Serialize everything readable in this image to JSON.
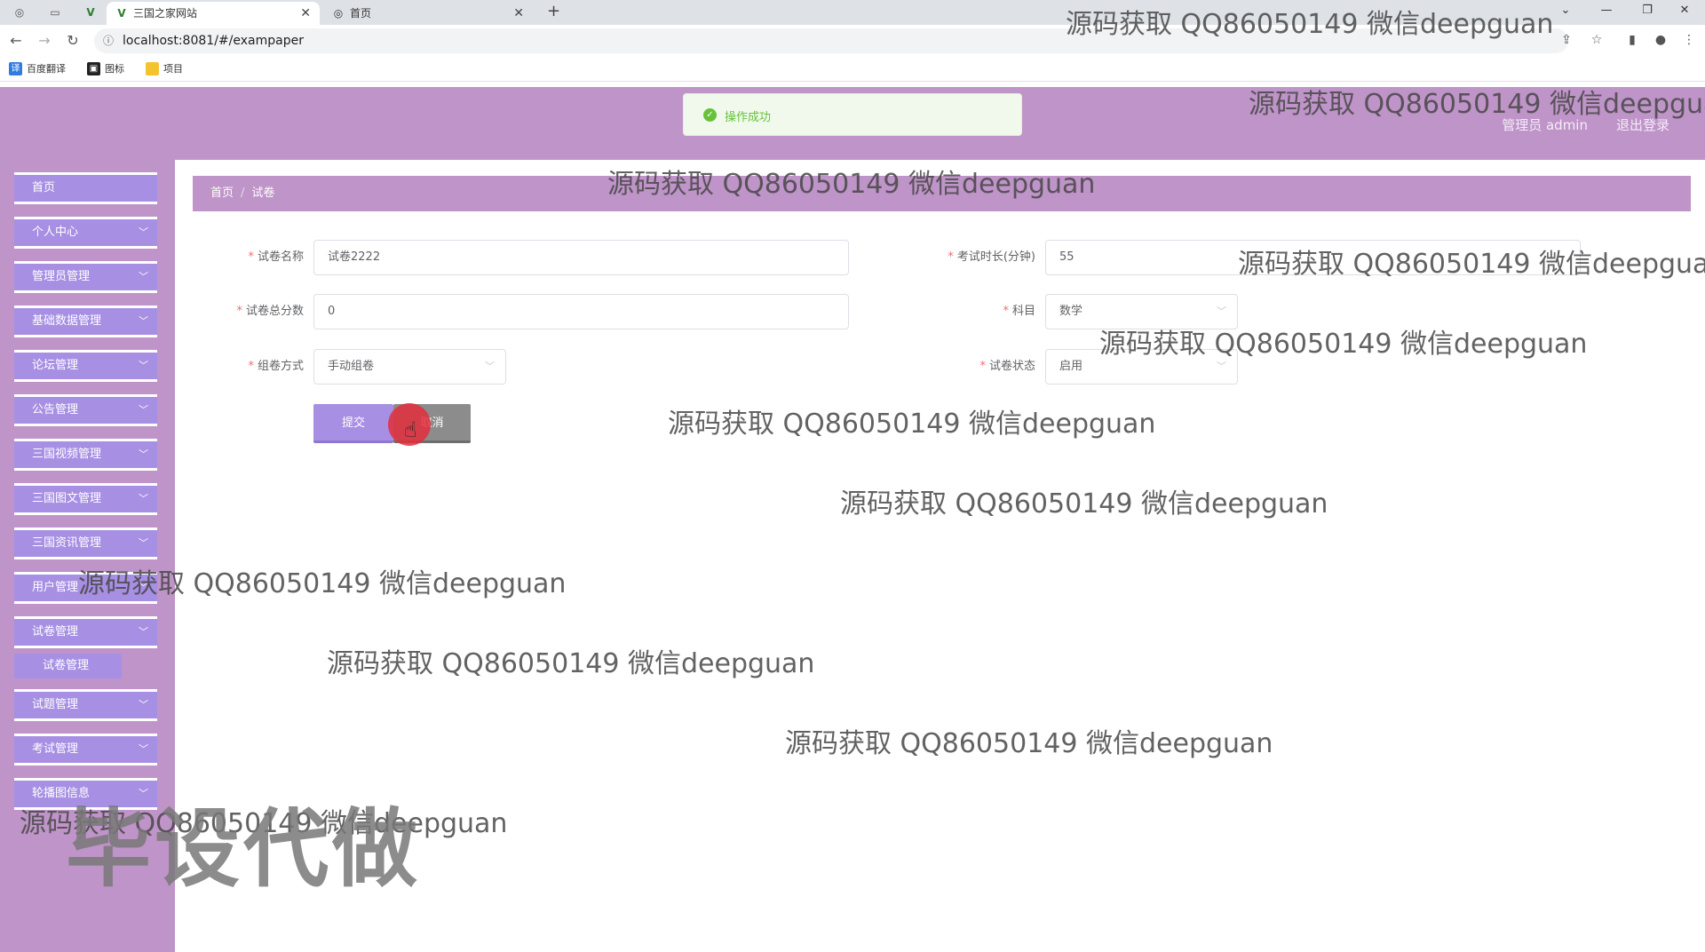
{
  "browser": {
    "tabs": [
      {
        "title": "三国之家网站",
        "active": true
      },
      {
        "title": "首页",
        "active": false
      }
    ],
    "url": "localhost:8081/#/exampaper",
    "bookmarks": [
      "百度翻译",
      "图标",
      "项目"
    ]
  },
  "header": {
    "site_title": "三国之家网站",
    "user_label": "管理员 admin",
    "logout_label": "退出登录"
  },
  "toast": {
    "message": "操作成功"
  },
  "sidebar": {
    "items": [
      {
        "label": "首页",
        "has_children": false
      },
      {
        "label": "个人中心",
        "has_children": true
      },
      {
        "label": "管理员管理",
        "has_children": true
      },
      {
        "label": "基础数据管理",
        "has_children": true
      },
      {
        "label": "论坛管理",
        "has_children": true
      },
      {
        "label": "公告管理",
        "has_children": true
      },
      {
        "label": "三国视频管理",
        "has_children": true
      },
      {
        "label": "三国图文管理",
        "has_children": true
      },
      {
        "label": "三国资讯管理",
        "has_children": true
      },
      {
        "label": "用户管理",
        "has_children": true
      },
      {
        "label": "试卷管理",
        "has_children": true
      },
      {
        "label": "试题管理",
        "has_children": true
      },
      {
        "label": "考试管理",
        "has_children": true
      },
      {
        "label": "轮播图信息",
        "has_children": true
      }
    ],
    "submenu": {
      "label": "试卷管理"
    }
  },
  "breadcrumb": {
    "home": "首页",
    "current": "试卷"
  },
  "form": {
    "paper_name": {
      "label": "试卷名称",
      "value": "试卷2222"
    },
    "duration": {
      "label": "考试时长(分钟)",
      "value": "55"
    },
    "total_score": {
      "label": "试卷总分数",
      "value": "0"
    },
    "subject": {
      "label": "科目",
      "value": "数学"
    },
    "compose_method": {
      "label": "组卷方式",
      "value": "手动组卷"
    },
    "status": {
      "label": "试卷状态",
      "value": "启用"
    },
    "submit_label": "提交",
    "cancel_label": "取消"
  },
  "watermarks": {
    "text": "源码获取 QQ86050149 微信deepguan",
    "text_cut": "源码获取 QQ86050149 微信deepgua",
    "big": "毕设代做"
  },
  "colors": {
    "header_bg": "#bf94c8",
    "menu_item_bg": "#a78fe3",
    "success": "#67c23a",
    "required": "#f56c6c"
  }
}
